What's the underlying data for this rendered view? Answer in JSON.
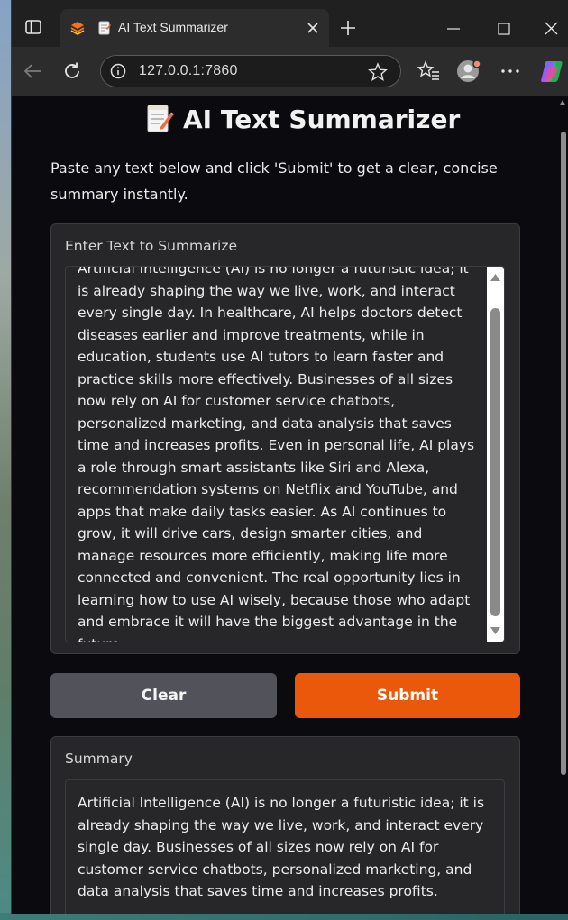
{
  "browser": {
    "tab": {
      "title": "AI Text Summarizer",
      "favicon": "gradio-logo-icon",
      "page_icon": "memo-icon"
    },
    "address": {
      "url": "127.0.0.1:7860"
    }
  },
  "app": {
    "title": "AI Text Summarizer",
    "description": "Paste any text below and click 'Submit' to get a clear, concise summary instantly.",
    "input": {
      "label": "Enter Text to Summarize",
      "value": "Artificial Intelligence (AI) is no longer a futuristic idea; it is already shaping the way we live, work, and interact every single day. In healthcare, AI helps doctors detect diseases earlier and improve treatments, while in education, students use AI tutors to learn faster and practice skills more effectively. Businesses of all sizes now rely on AI for customer service chatbots, personalized marketing, and data analysis that saves time and increases profits. Even in personal life, AI plays a role through smart assistants like Siri and Alexa, recommendation systems on Netflix and YouTube, and apps that make daily tasks easier. As AI continues to grow, it will drive cars, design smarter cities, and manage resources more efficiently, making life more connected and convenient. The real opportunity lies in learning how to use AI wisely, because those who adapt and embrace it will have the biggest advantage in the future."
    },
    "buttons": {
      "clear": "Clear",
      "submit": "Submit"
    },
    "output": {
      "label": "Summary",
      "value": "Artificial Intelligence (AI) is no longer a futuristic idea; it is already shaping the way we live, work, and interact every single day. Businesses of all sizes now rely on AI for customer service chatbots, personalized marketing, and data analysis that saves time and increases profits."
    }
  },
  "colors": {
    "accent": "#ea580c",
    "secondary_button": "#52525b",
    "panel": "#27272a",
    "page_bg": "#0b0b0f"
  }
}
